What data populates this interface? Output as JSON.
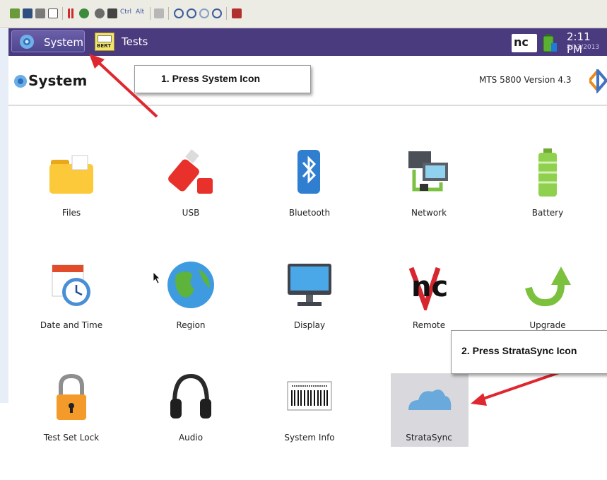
{
  "titlebar": {
    "system_tab": "System",
    "tests_tab": "Tests",
    "bert_badge": "BERT",
    "nc_badge": "nc",
    "time": "2:11 PM",
    "date": "8/13/2013"
  },
  "header": {
    "title": "System",
    "version": "MTS 5800 Version 4.3"
  },
  "toolbar": {
    "ctrl_label": "Ctrl",
    "alt_label": "Alt"
  },
  "callouts": {
    "step1": "1. Press System Icon",
    "step2": "2. Press StrataSync Icon"
  },
  "icons": [
    {
      "label": "Files",
      "icon": "folder-icon"
    },
    {
      "label": "USB",
      "icon": "usb-icon"
    },
    {
      "label": "Bluetooth",
      "icon": "bluetooth-icon"
    },
    {
      "label": "Network",
      "icon": "network-icon"
    },
    {
      "label": "Battery",
      "icon": "battery-icon"
    },
    {
      "label": "Date and Time",
      "icon": "calendar-clock-icon"
    },
    {
      "label": "Region",
      "icon": "globe-icon"
    },
    {
      "label": "Display",
      "icon": "monitor-icon"
    },
    {
      "label": "Remote",
      "icon": "remote-nc-icon"
    },
    {
      "label": "Upgrade",
      "icon": "upgrade-arrow-icon"
    },
    {
      "label": "Test Set Lock",
      "icon": "padlock-icon"
    },
    {
      "label": "Audio",
      "icon": "headphones-icon"
    },
    {
      "label": "System Info",
      "icon": "barcode-icon"
    },
    {
      "label": "StrataSync",
      "icon": "cloud-icon"
    }
  ],
  "colors": {
    "titlebar": "#4a3a7e",
    "callout_arrow": "#e0262e",
    "strata_highlight": "#d9d9dd"
  }
}
